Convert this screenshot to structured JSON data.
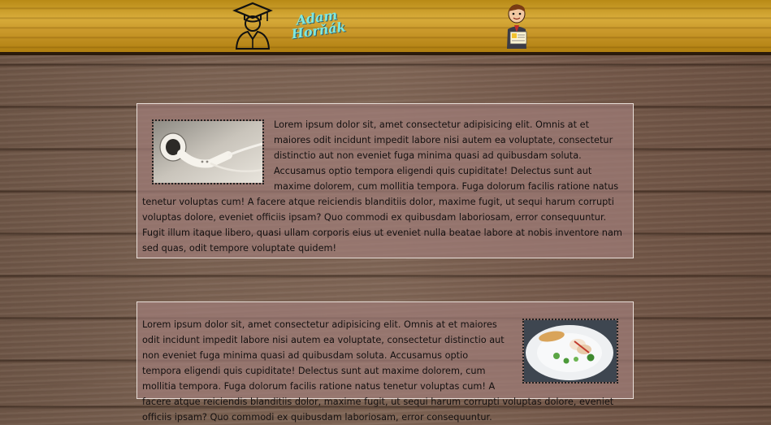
{
  "header": {
    "brand_text": "Adam Horňák",
    "logo_icon": "graduate-icon",
    "mascot_icon": "mascot-icon"
  },
  "articles": [
    {
      "image": "earphones-image",
      "text": "Lorem ipsum dolor sit, amet consectetur adipisicing elit. Omnis at et maiores odit incidunt impedit labore nisi autem ea voluptate, consectetur distinctio aut non eveniet fuga minima quasi ad quibusdam soluta. Accusamus optio tempora eligendi quis cupiditate! Delectus sunt aut maxime dolorem, cum mollitia tempora. Fuga dolorum facilis ratione natus tenetur voluptas cum! A facere atque reiciendis blanditiis dolor, maxime fugit, ut sequi harum corrupti voluptas dolore, eveniet officiis ipsam? Quo commodi ex quibusdam laboriosam, error consequuntur. Fugit illum itaque libero, quasi ullam corporis eius ut eveniet nulla beatae labore at nobis inventore nam sed quas, odit tempore voluptate quidem!"
    },
    {
      "image": "food-plate-image",
      "text": "Lorem ipsum dolor sit, amet consectetur adipisicing elit. Omnis at et maiores odit incidunt impedit labore nisi autem ea voluptate, consectetur distinctio aut non eveniet fuga minima quasi ad quibusdam soluta. Accusamus optio tempora eligendi quis cupiditate! Delectus sunt aut maxime dolorem, cum mollitia tempora. Fuga dolorum facilis ratione natus tenetur voluptas cum! A facere atque reiciendis blanditiis dolor, maxime fugit, ut sequi harum corrupti voluptas dolore, eveniet officiis ipsam? Quo commodi ex quibusdam laboriosam, error consequuntur."
    }
  ]
}
